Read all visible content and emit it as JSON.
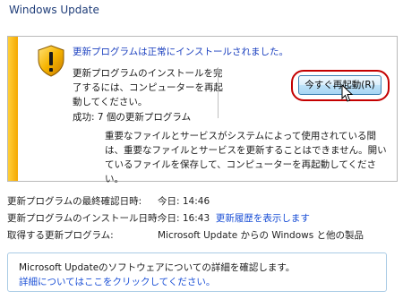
{
  "window": {
    "title": "Windows Update"
  },
  "status_panel": {
    "heading": "更新プログラムは正常にインストールされました。",
    "body": "更新プログラムのインストールを完了するには、コンピューターを再起動してください。",
    "count": "成功: 7 個の更新プログラム",
    "restart_button": "今すぐ再起動(R)",
    "warning": "重要なファイルとサービスがシステムによって使用されている間は、重要なファイルとサービスを更新することはできません。開いているファイルを保存して、コンピューターを再起動してください。",
    "shield_icon": "warning-shield-icon"
  },
  "info": {
    "rows": [
      {
        "label": "更新プログラムの最終確認日時:",
        "value": "今日: 14:46"
      },
      {
        "label": "更新プログラムのインストール日時:",
        "value": "今日: 16:43",
        "link": "更新履歴を表示します"
      },
      {
        "label": "取得する更新プログラム:",
        "value": "Microsoft Update からの Windows と他の製品"
      }
    ]
  },
  "info_box": {
    "text": "Microsoft Updateのソフトウェアについての詳細を確認します。",
    "link": "詳細についてはここをクリックしてください。"
  },
  "colors": {
    "link": "#1a4fd6",
    "heading": "#1a3fbf",
    "stripe": "#f5a800",
    "highlight_ring": "#c40000"
  }
}
